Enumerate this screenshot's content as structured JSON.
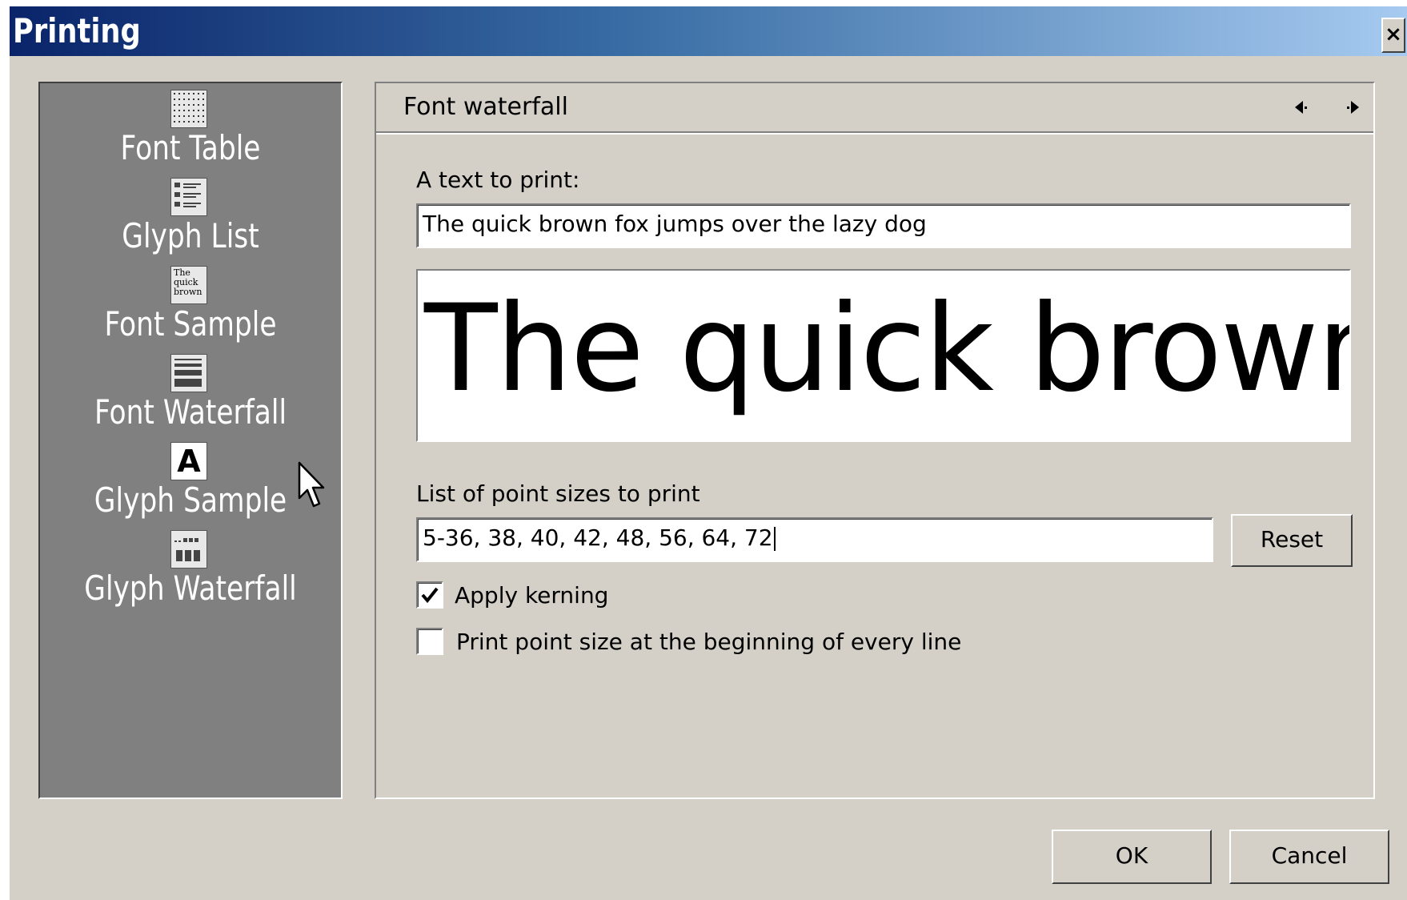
{
  "window": {
    "title": "Printing",
    "close_label": "×"
  },
  "sidebar": {
    "items": [
      {
        "label": "Font Table",
        "icon": "font-table-icon"
      },
      {
        "label": "Glyph List",
        "icon": "glyph-list-icon"
      },
      {
        "label": "Font Sample",
        "icon": "font-sample-icon",
        "icon_text": [
          "The",
          "quick",
          "brown"
        ]
      },
      {
        "label": "Font Waterfall",
        "icon": "font-waterfall-icon",
        "selected": true
      },
      {
        "label": "Glyph Sample",
        "icon": "glyph-sample-icon",
        "icon_text": "A"
      },
      {
        "label": "Glyph Waterfall",
        "icon": "glyph-waterfall-icon"
      }
    ]
  },
  "panel": {
    "title": "Font waterfall",
    "text_label": "A text to print:",
    "text_value": "The quick brown fox jumps over the lazy dog",
    "preview_text": "The quick brown fox jumps over the lazy dog",
    "sizes_label": "List of point sizes to print",
    "sizes_value": "5-36, 38, 40, 42, 48, 56, 64, 72",
    "reset_label": "Reset",
    "kerning_label": "Apply kerning",
    "kerning_checked": true,
    "print_size_label": "Print point size at the beginning of every line",
    "print_size_checked": false
  },
  "buttons": {
    "ok": "OK",
    "cancel": "Cancel"
  }
}
